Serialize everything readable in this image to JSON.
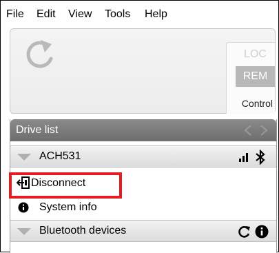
{
  "menu": {
    "file": "File",
    "edit": "Edit",
    "view": "View",
    "tools": "Tools",
    "help": "Help"
  },
  "toolbar": {
    "loc_label": "LOC",
    "rem_label": "REM",
    "control_label": "Control",
    "refresh_icon": "refresh-icon"
  },
  "drive_list": {
    "title": "Drive list",
    "devices": [
      {
        "name": "ACH531",
        "icons": [
          "signal-icon",
          "bluetooth-icon"
        ]
      }
    ],
    "actions": [
      {
        "label": "Disconnect",
        "icon": "disconnect-icon"
      },
      {
        "label": "System info",
        "icon": "info-icon"
      }
    ],
    "bluetooth_group": {
      "title": "Bluetooth devices",
      "icons": [
        "refresh-icon",
        "info-icon"
      ]
    }
  },
  "colors": {
    "highlight": "#e31b23",
    "header_bg": "#7a7a7a",
    "rem_bg": "#b8b8b8"
  }
}
